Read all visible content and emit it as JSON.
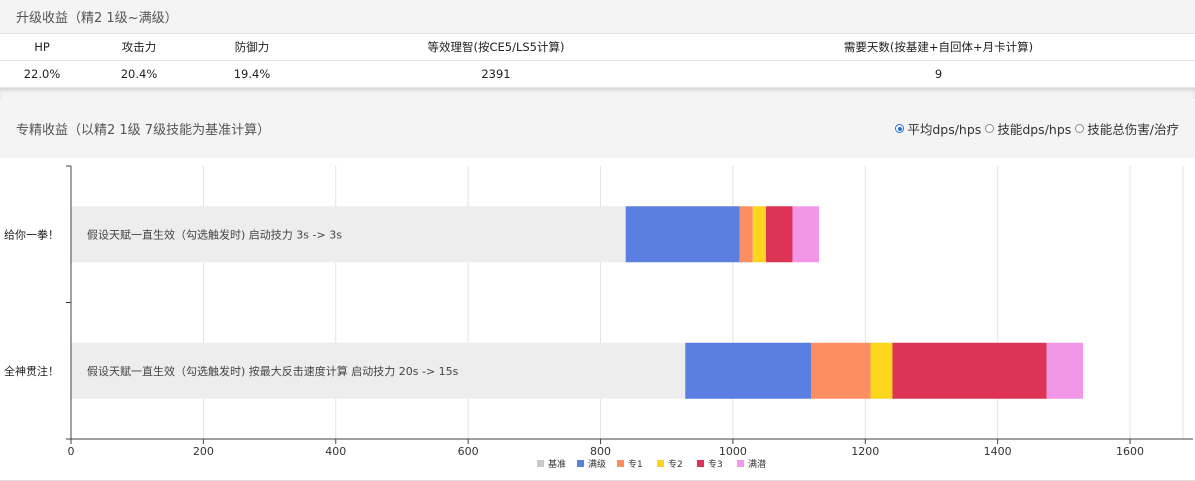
{
  "upgrade": {
    "title": "升级收益（精2 1级~满级）",
    "headers": [
      "HP",
      "攻击力",
      "防御力",
      "等效理智(按CE5/LS5计算)",
      "需要天数(按基建+自回体+月卡计算)"
    ],
    "values": [
      "22.0%",
      "20.4%",
      "19.4%",
      "2391",
      "9"
    ]
  },
  "mastery": {
    "title": "专精收益（以精2 1级 7级技能为基准计算）",
    "options": [
      "平均dps/hps",
      "技能dps/hps",
      "技能总伤害/治疗"
    ],
    "selected_index": 0
  },
  "chart_data": {
    "type": "bar",
    "orientation": "horizontal",
    "stacked": true,
    "categories": [
      "给你一拳！",
      "全神贯注！"
    ],
    "bar_annotations": [
      "假设天赋一直生效（勾选触发时) 启动技力 3s -> 3s",
      "假设天赋一直生效（勾选触发时) 按最大反击速度计算 启动技力 20s -> 15s"
    ],
    "series": [
      {
        "name": "基准",
        "color": "#ededed",
        "values": [
          838,
          928
        ]
      },
      {
        "name": "满级",
        "color": "#5b7fe0",
        "values": [
          172,
          190
        ]
      },
      {
        "name": "专1",
        "color": "#fc8e61",
        "values": [
          20,
          90
        ]
      },
      {
        "name": "专2",
        "color": "#fcd61c",
        "values": [
          20,
          33
        ]
      },
      {
        "name": "专3",
        "color": "#dd3455",
        "values": [
          40,
          233
        ]
      },
      {
        "name": "满潜",
        "color": "#f296e8",
        "values": [
          40,
          55
        ]
      }
    ],
    "xticks": [
      0,
      200,
      400,
      600,
      800,
      1000,
      1200,
      1400,
      1600
    ],
    "xlim": [
      0,
      1680
    ],
    "grid": true,
    "legend_position": "bottom"
  }
}
